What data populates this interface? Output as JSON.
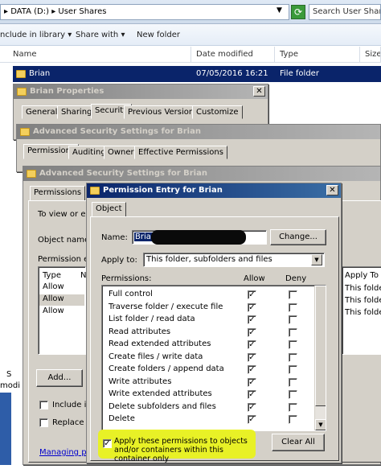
{
  "explorer": {
    "address": "▸ DATA (D:) ▸ User Shares",
    "search_placeholder": "Search User Shares",
    "toolbar": {
      "include_library": "nclude in library",
      "share_with": "Share with",
      "new_folder": "New folder"
    },
    "columns": {
      "name": "Name",
      "date_modified": "Date modified",
      "type": "Type",
      "size": "Size"
    },
    "row": {
      "name": "Brian",
      "date": "07/05/2016 16:21",
      "type": "File folder"
    }
  },
  "properties": {
    "title": "Brian Properties",
    "tabs": [
      "General",
      "Sharing",
      "Security",
      "Previous Versions",
      "Customize"
    ]
  },
  "adv1": {
    "title": "Advanced Security Settings for Brian",
    "tabs": [
      "Permissions",
      "Auditing",
      "Owner",
      "Effective Permissions"
    ]
  },
  "adv2": {
    "title": "Advanced Security Settings for Brian",
    "tab": "Permissions",
    "to_view": "To view or edi",
    "object_name": "Object name:",
    "perm_entries": "Permission ent",
    "list_header_type": "Type",
    "list_header_n": "N",
    "types": [
      "Allow",
      "Allow",
      "Allow"
    ],
    "apply_to_header": "Apply To",
    "apply_to_vals": [
      "This folder_",
      "This folder_",
      "This folder_"
    ],
    "add_btn": "Add...",
    "include_inh": "Include inh",
    "replace_all": "Replace al",
    "managing": "Managing perr"
  },
  "left_stub": {
    "s": "S",
    "modi": "modi"
  },
  "entry": {
    "title": "Permission Entry for Brian",
    "tab": "Object",
    "name_label": "Name:",
    "name_value": "Brian",
    "change_btn": "Change...",
    "apply_to_label": "Apply to:",
    "apply_to_value": "This folder, subfolders and files",
    "permissions_label": "Permissions:",
    "allow_label": "Allow",
    "deny_label": "Deny",
    "permissions": [
      "Full control",
      "Traverse folder / execute file",
      "List folder / read data",
      "Read attributes",
      "Read extended attributes",
      "Create files / write data",
      "Create folders / append data",
      "Write attributes",
      "Write extended attributes",
      "Delete subfolders and files",
      "Delete"
    ],
    "apply_check_text": "Apply these permissions to objects and/or containers within this container only",
    "clear_all_btn": "Clear All"
  },
  "icons": {
    "check": "✓",
    "close": "✕"
  },
  "colors": {
    "highlight": "#e9f21e",
    "title_active": "#0a246a"
  }
}
